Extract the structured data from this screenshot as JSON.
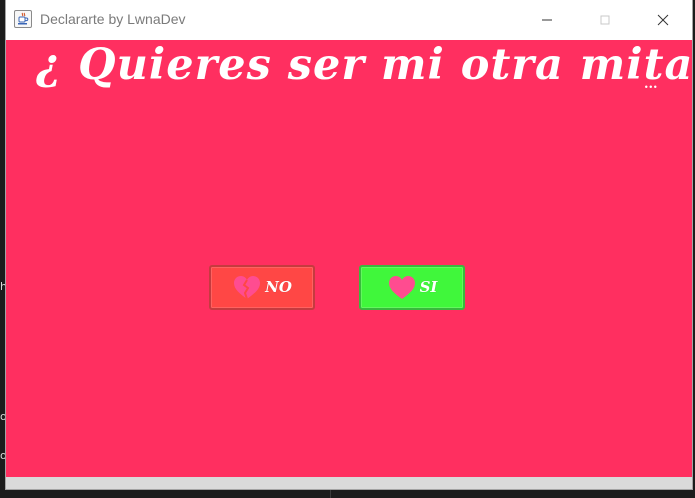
{
  "window": {
    "title": "Declararte by LwnaDev",
    "icon": "java-coffee-icon"
  },
  "title_controls": {
    "minimize_icon": "minimize-icon",
    "maximize_icon": "maximize-icon",
    "close_icon": "close-icon"
  },
  "main": {
    "question": "¿ Quieres ser mi otra mitad ?",
    "ellipsis": "...",
    "no_button": {
      "label": "NO",
      "icon": "broken-heart-icon",
      "color": "#ff4745"
    },
    "yes_button": {
      "label": "SI",
      "icon": "heart-icon",
      "color": "#40f73b"
    },
    "background_color": "#ff2f60"
  }
}
